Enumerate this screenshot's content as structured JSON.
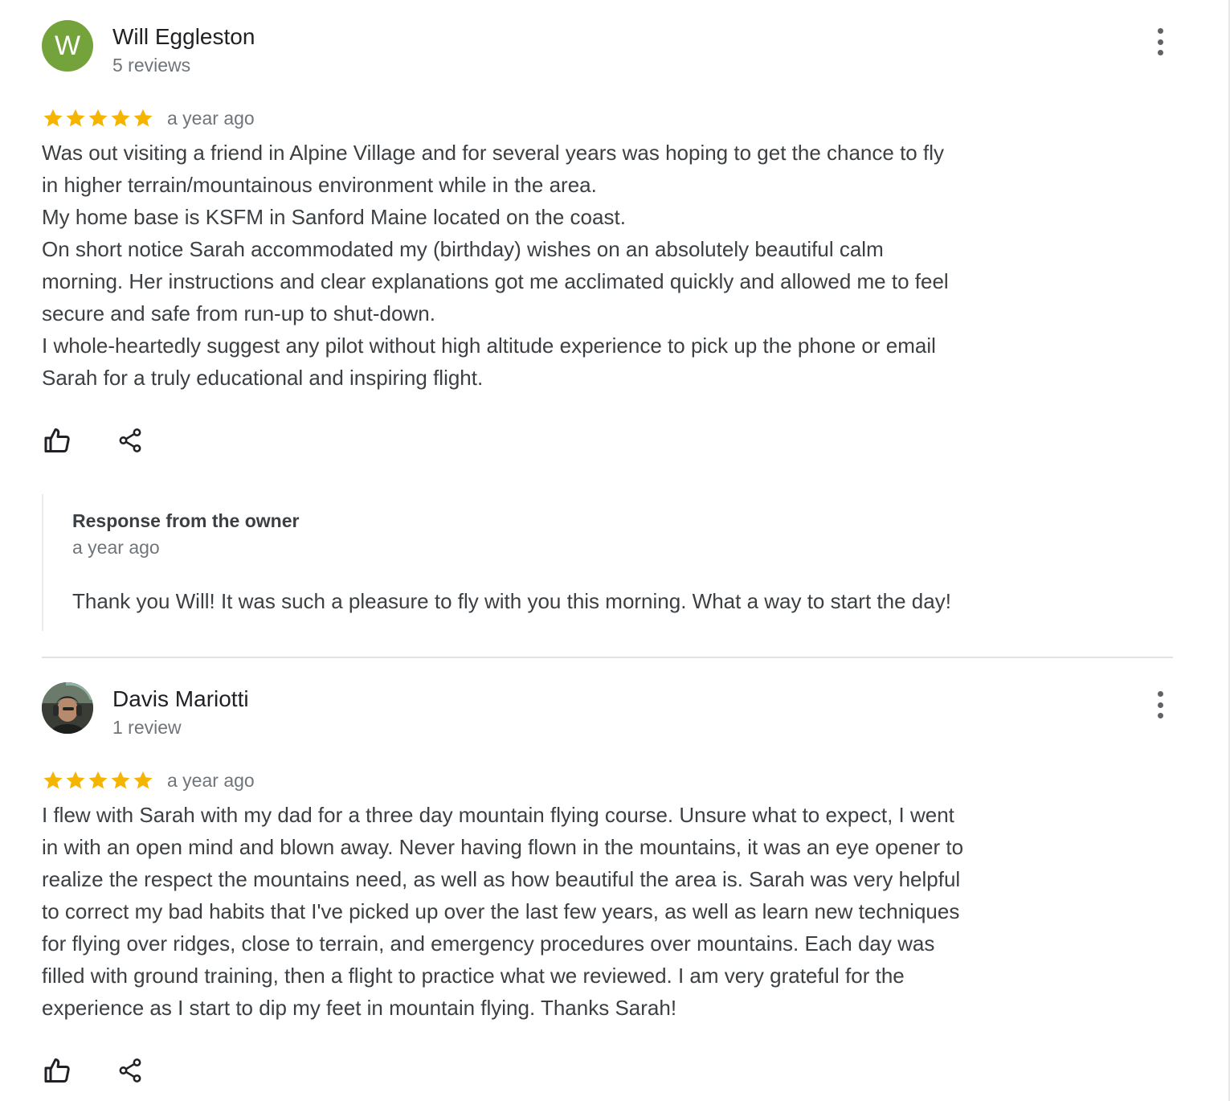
{
  "reviews": [
    {
      "avatar_letter": "W",
      "avatar_color": "#74a33c",
      "name": "Will Eggleston",
      "review_count": "5 reviews",
      "rating": 5,
      "date": "a year ago",
      "lines": [
        "Was out visiting a friend in Alpine Village and for several years was hoping to get the chance to fly",
        "in higher terrain/mountainous environment while in the area.",
        "My home base is KSFM in Sanford Maine located on the coast.",
        "On short notice Sarah accommodated my (birthday) wishes on an absolutely beautiful calm",
        "morning. Her instructions and clear explanations got me acclimated quickly and allowed me to feel",
        "secure and safe from run-up to shut-down.",
        "I whole-heartedly suggest any pilot without high altitude experience to pick up the phone or email",
        "Sarah for a truly educational and inspiring flight."
      ],
      "owner_response": {
        "title": "Response from the owner",
        "date": "a year ago",
        "text": "Thank you Will! It was such a pleasure to fly with you this morning. What a way to start the day!"
      }
    },
    {
      "avatar_letter": "",
      "name": "Davis Mariotti",
      "review_count": "1 review",
      "rating": 5,
      "date": "a year ago",
      "lines": [
        "I flew with Sarah with my dad for a three day mountain flying course. Unsure what to expect, I went",
        "in with an open mind and blown away. Never having flown in the mountains, it was an eye opener to",
        "realize the respect the mountains need, as well as how beautiful the area is. Sarah was very helpful",
        "to correct my bad habits that I've picked up over the last few years, as well as learn new techniques",
        "for flying over ridges, close to terrain, and emergency procedures over mountains. Each day was",
        "filled with ground training, then a flight to practice what we reviewed. I am very grateful for the",
        "experience as I start to dip my feet in mountain flying. Thanks Sarah!"
      ]
    }
  ],
  "icons": {
    "star": "star-icon",
    "like": "thumbs-up-icon",
    "share": "share-icon",
    "more": "more-vertical-icon"
  },
  "colors": {
    "star": "#f4b400",
    "avatar_green": "#74a33c",
    "muted_text": "#70757a"
  }
}
